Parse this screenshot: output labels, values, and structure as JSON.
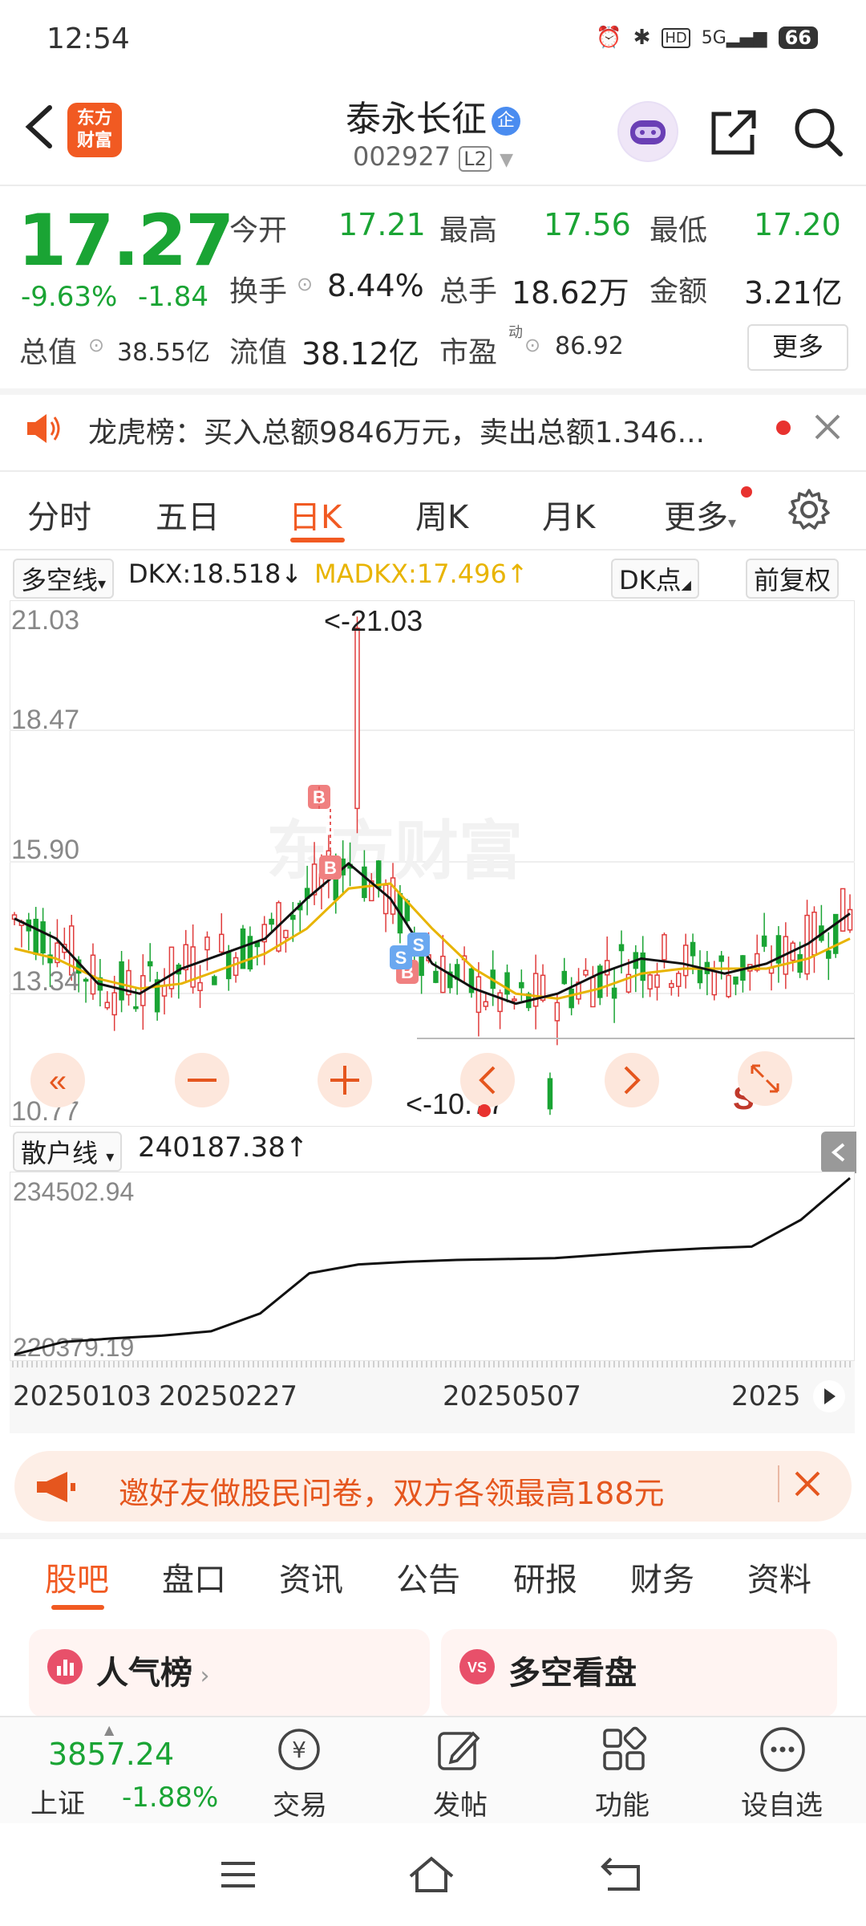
{
  "status": {
    "time": "12:54",
    "icons": [
      "alarm-icon",
      "bluetooth-icon",
      "hd-icon",
      "5g-signal-icon"
    ],
    "battery": "66"
  },
  "header": {
    "logo": "东方\n财富",
    "name": "泰永长征",
    "badge": "企",
    "code": "002927",
    "level": "L2"
  },
  "quote": {
    "price": "17.27",
    "pct": "-9.63%",
    "chg": "-1.84",
    "open_label": "今开",
    "open": "17.21",
    "high_label": "最高",
    "high": "17.56",
    "low_label": "最低",
    "low": "17.20",
    "turnover_label": "换手",
    "turnover": "8.44%",
    "vol_label": "总手",
    "vol": "18.62万",
    "amount_label": "金额",
    "amount": "3.21亿",
    "mcap_label": "总值",
    "mcap": "38.55亿",
    "float_label": "流值",
    "float": "38.12亿",
    "pe_label": "市盈",
    "pe_sup": "动",
    "pe": "86.92",
    "more": "更多"
  },
  "notice": {
    "text": "龙虎榜：买入总额9846万元，卖出总额1.346..."
  },
  "tabs": [
    "分时",
    "五日",
    "日K",
    "周K",
    "月K",
    "更多"
  ],
  "active_tab": "日K",
  "indicator": {
    "name": "多空线",
    "dkx": "DKX:18.518↓",
    "madkx": "MADKX:17.496↑",
    "dk_btn": "DK点",
    "adj_btn": "前复权"
  },
  "kchart": {
    "y_labels": [
      "21.03",
      "18.47",
      "15.90",
      "13.34",
      "10.77"
    ],
    "max_label": "<-21.03",
    "min_label": "<-10.77",
    "watermark": "东方财富",
    "marker_s": "S",
    "markers": [
      "B",
      "B",
      "B",
      "S",
      "S"
    ]
  },
  "subchart": {
    "name": "散户线",
    "value": "240187.38↑",
    "top": "234502.94",
    "bottom": "220379.19"
  },
  "xaxis": [
    "20250103",
    "20250227",
    "20250507",
    "2025"
  ],
  "chart_data": [
    {
      "type": "line",
      "title": "DKX",
      "xlabel": "",
      "ylabel": "",
      "x_ticks": [
        "20250103",
        "20250227",
        "20250507",
        "2025"
      ],
      "ylim": [
        10.77,
        21.03
      ],
      "series": [
        {
          "name": "DKX",
          "values": [
            14.8,
            14.4,
            13.5,
            13.3,
            13.8,
            14.1,
            14.4,
            15.2,
            15.9,
            15.2,
            13.9,
            13.4,
            13.1,
            13.3,
            13.7,
            14.0,
            13.9,
            13.7,
            13.9,
            14.3,
            14.9
          ]
        },
        {
          "name": "MADKX",
          "values": [
            14.2,
            14.0,
            13.6,
            13.4,
            13.5,
            13.8,
            14.1,
            14.6,
            15.4,
            15.5,
            14.6,
            13.8,
            13.3,
            13.2,
            13.4,
            13.7,
            13.8,
            13.8,
            13.8,
            14.0,
            14.4
          ]
        }
      ]
    },
    {
      "type": "line",
      "title": "散户线",
      "ylim": [
        220379.19,
        240187.38
      ],
      "series": [
        {
          "name": "散户线",
          "values": [
            220400,
            221800,
            222200,
            222500,
            223000,
            225000,
            229500,
            230500,
            230800,
            231000,
            231100,
            231200,
            231600,
            232000,
            232300,
            232500,
            235500,
            240187.38
          ]
        }
      ]
    }
  ],
  "banner": {
    "text": "邀好友做股民问卷，双方各领最高188元"
  },
  "bottom_tabs": [
    "股吧",
    "盘口",
    "资讯",
    "公告",
    "研报",
    "财务",
    "资料"
  ],
  "cards": [
    {
      "title": "人气榜"
    },
    {
      "title": "多空看盘"
    }
  ],
  "index": {
    "value": "3857.24",
    "name": "上证",
    "pct": "-1.88%"
  },
  "nav": [
    {
      "label": "交易"
    },
    {
      "label": "发帖"
    },
    {
      "label": "功能"
    },
    {
      "label": "设自选"
    }
  ]
}
